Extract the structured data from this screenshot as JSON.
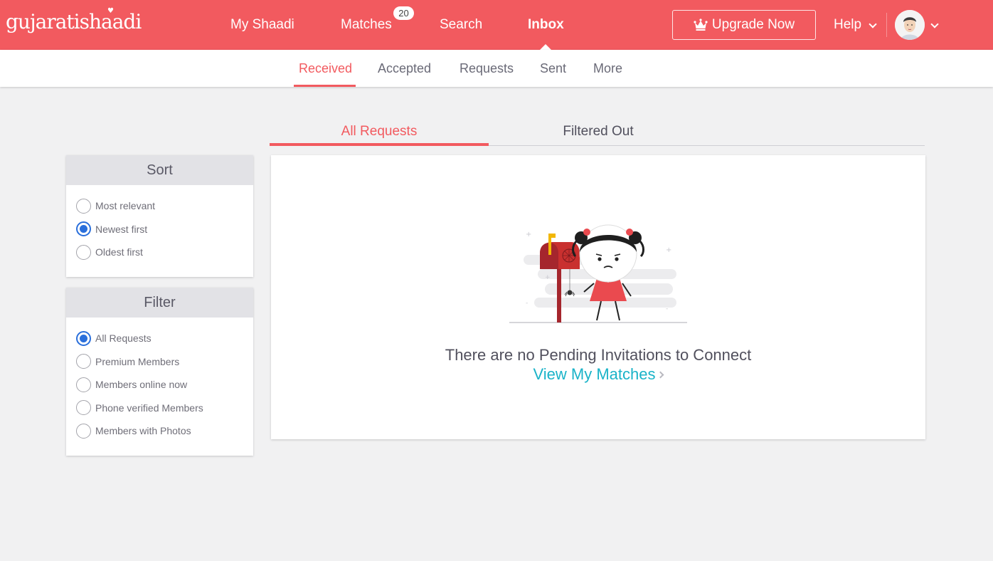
{
  "brand": {
    "logo_text": "gujaratishaadi",
    "accent": "#f25a5f",
    "link_color": "#1ab3c8",
    "radio_color": "#2a6fdb"
  },
  "topnav": {
    "items": [
      {
        "label": "My Shaadi"
      },
      {
        "label": "Matches",
        "badge": "20"
      },
      {
        "label": "Search"
      },
      {
        "label": "Inbox",
        "active": true
      }
    ],
    "upgrade_label": "Upgrade Now",
    "upgrade_icon": "crown-icon",
    "help_label": "Help"
  },
  "subnav": {
    "tabs": [
      {
        "label": "Received",
        "active": true
      },
      {
        "label": "Accepted"
      },
      {
        "label": "Requests"
      },
      {
        "label": "Sent"
      },
      {
        "label": "More"
      }
    ]
  },
  "content_tabs": [
    {
      "label": "All Requests",
      "active": true
    },
    {
      "label": "Filtered Out"
    }
  ],
  "sort": {
    "title": "Sort",
    "options": [
      {
        "label": "Most relevant",
        "checked": false
      },
      {
        "label": "Newest first",
        "checked": true
      },
      {
        "label": "Oldest first",
        "checked": false
      }
    ]
  },
  "filter": {
    "title": "Filter",
    "options": [
      {
        "label": "All Requests",
        "checked": true
      },
      {
        "label": "Premium Members",
        "checked": false
      },
      {
        "label": "Members online now",
        "checked": false
      },
      {
        "label": "Phone verified Members",
        "checked": false
      },
      {
        "label": "Members with Photos",
        "checked": false
      }
    ]
  },
  "empty_state": {
    "message": "There are no Pending Invitations to Connect",
    "link_label": "View My Matches",
    "illustration": "sad-girl-mailbox-illustration"
  }
}
